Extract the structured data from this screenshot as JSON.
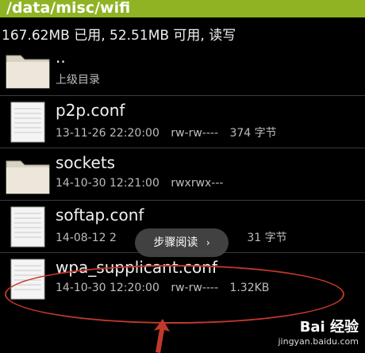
{
  "header": {
    "path": "/data/misc/wifi"
  },
  "storage": {
    "summary": "167.62MB 已用, 52.51MB 可用, 读写"
  },
  "files": [
    {
      "name": "..",
      "meta_date": "上级目录",
      "meta_perm": "",
      "meta_size": "",
      "type": "folder"
    },
    {
      "name": "p2p.conf",
      "meta_date": "13-11-26 22:20:00",
      "meta_perm": "rw-rw----",
      "meta_size": "374 字节",
      "type": "file"
    },
    {
      "name": "sockets",
      "meta_date": "14-10-30 12:21:00",
      "meta_perm": "rwxrwx---",
      "meta_size": "",
      "type": "folder"
    },
    {
      "name": "softap.conf",
      "meta_date": "14-08-12 2",
      "meta_perm": "",
      "meta_size": "31 字节",
      "type": "file"
    },
    {
      "name": "wpa_supplicant.conf",
      "meta_date": "14-10-30 12:20:00",
      "meta_perm": "rw-rw----",
      "meta_size": "1.32KB",
      "type": "file"
    }
  ],
  "toast": {
    "label": "步骤阅读"
  },
  "watermark": {
    "brand": "Bai 经验",
    "url": "jingyan.baidu.com"
  },
  "colors": {
    "path_bar": "#8fb323",
    "highlight": "#c0392b"
  }
}
